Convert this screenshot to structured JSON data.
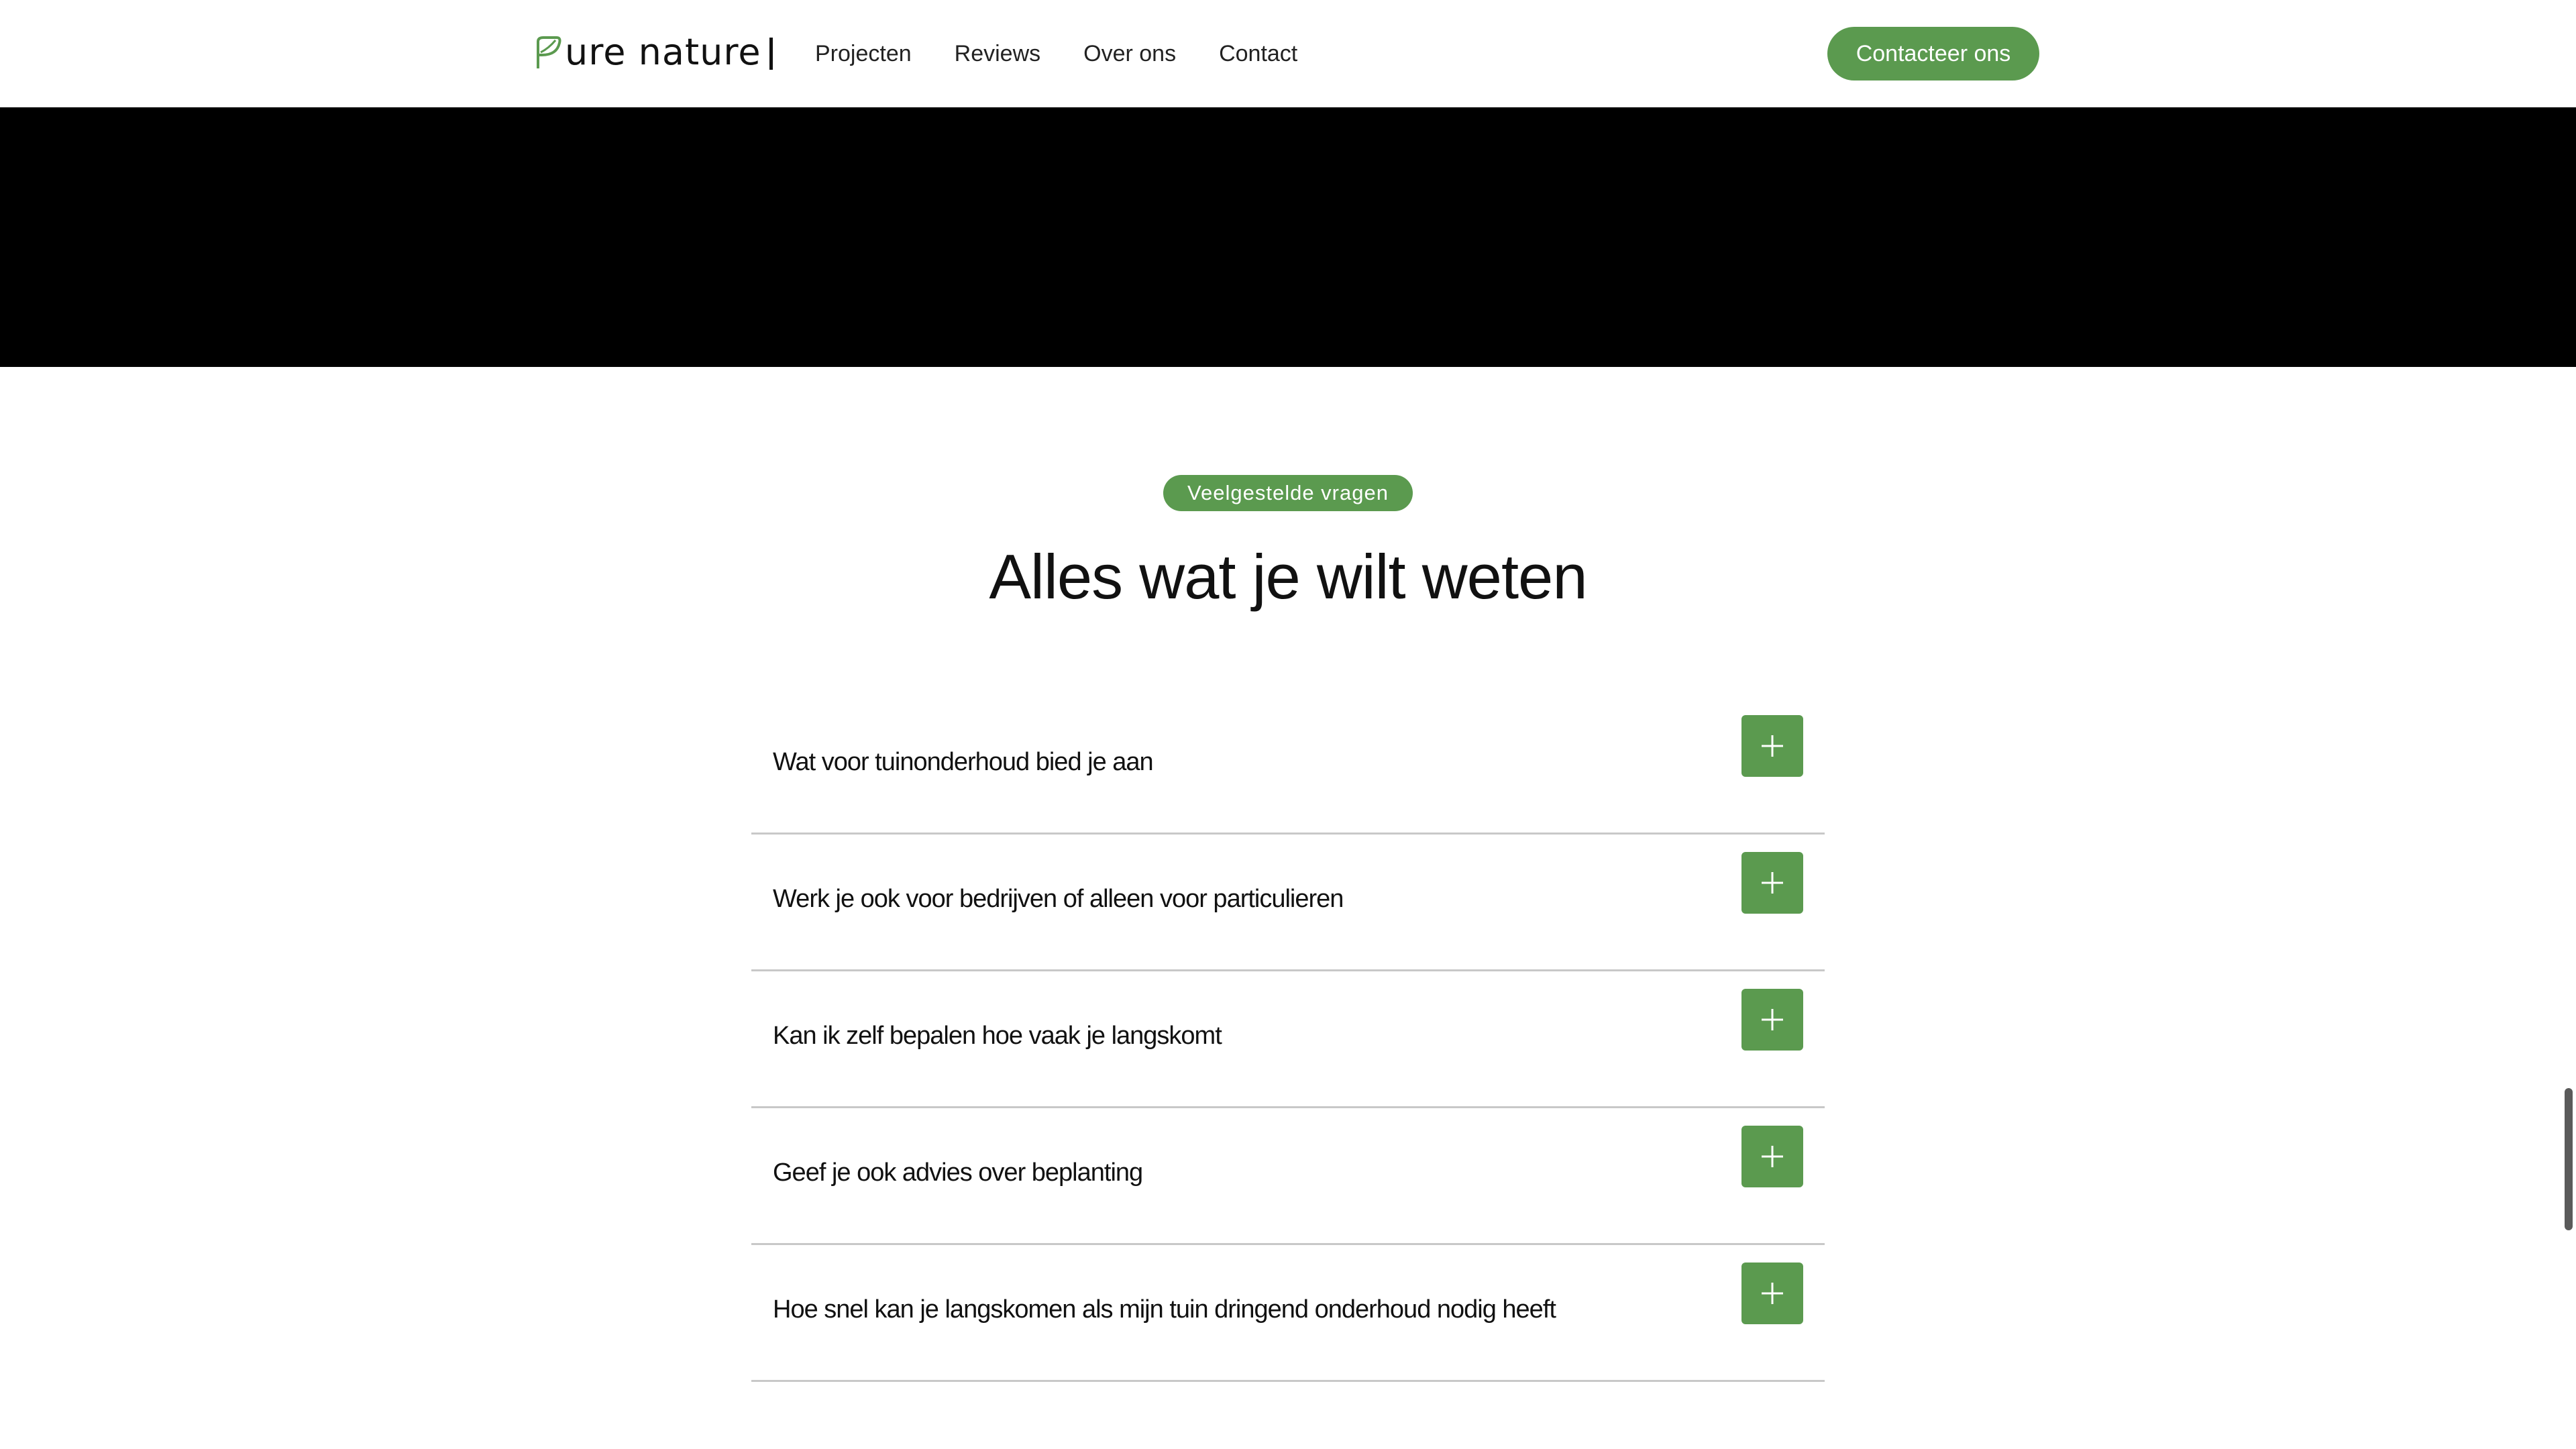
{
  "header": {
    "logo_text": "ure nature",
    "logo_icon": "leaf-p-icon",
    "nav": [
      "Projecten",
      "Reviews",
      "Over ons",
      "Contact"
    ],
    "cta_label": "Contacteer ons"
  },
  "faq": {
    "badge": "Veelgestelde vragen",
    "title": "Alles wat je wilt weten",
    "items": [
      "Wat voor tuinonderhoud bied je aan",
      "Werk je ook voor bedrijven of alleen voor particulieren",
      "Kan ik zelf bepalen hoe vaak je langskomt",
      "Geef je ook advies over beplanting",
      "Hoe snel kan je langskomen als mijn tuin dringend onderhoud nodig heeft"
    ],
    "toggle_icon": "plus-icon"
  },
  "colors": {
    "accent": "#5b9a4f",
    "text": "#111111",
    "divider": "#c8c8c8",
    "video_bg": "#000000"
  }
}
